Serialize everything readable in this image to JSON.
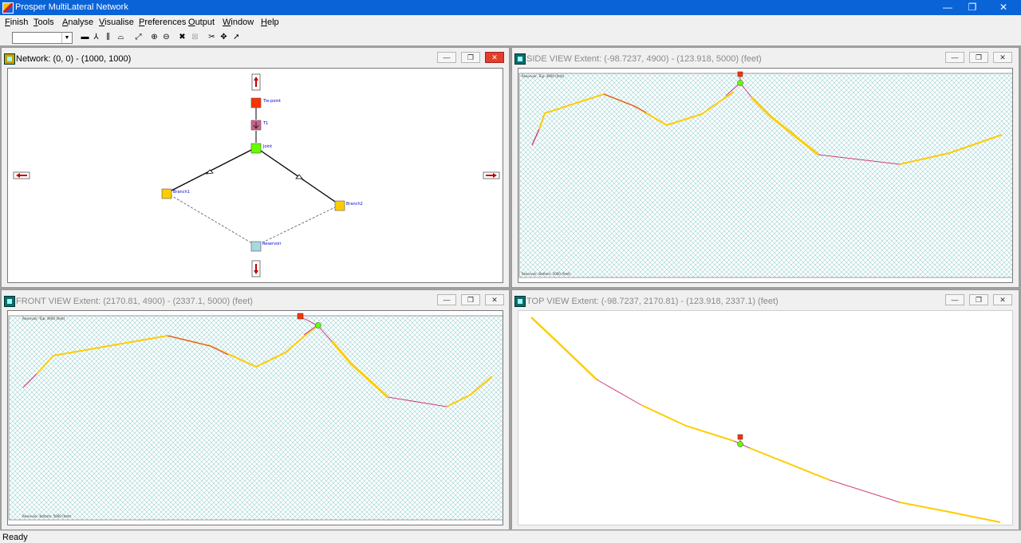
{
  "app": {
    "title": "Prosper MultiLateral Network"
  },
  "window_controls": {
    "minimize": "—",
    "restore": "❐",
    "close": "✕"
  },
  "menu": [
    {
      "label": "Finish",
      "u": "F"
    },
    {
      "label": "Tools",
      "u": "T"
    },
    {
      "label": "Analyse",
      "u": "A"
    },
    {
      "label": "Visualise",
      "u": "V"
    },
    {
      "label": "Preferences",
      "u": "P"
    },
    {
      "label": "Output",
      "u": "O"
    },
    {
      "label": "Window",
      "u": "W"
    },
    {
      "label": "Help",
      "u": "H"
    }
  ],
  "toolbar": {
    "combo_value": "",
    "combo_arrow": "▼",
    "buttons": [
      {
        "name": "line-tool-icon",
        "glyph": "▬"
      },
      {
        "name": "branch-tool-icon",
        "glyph": "⅄"
      },
      {
        "name": "pump-tool-icon",
        "glyph": "⫼"
      },
      {
        "name": "tank-tool-icon",
        "glyph": "⌓"
      },
      {
        "name": "zoom-fit-icon",
        "glyph": "⤢"
      },
      {
        "name": "zoom-in-icon",
        "glyph": "⊕"
      },
      {
        "name": "zoom-out-icon",
        "glyph": "⊖"
      },
      {
        "name": "delete-icon",
        "glyph": "✖"
      },
      {
        "name": "delete-disabled-icon",
        "glyph": "⊠"
      },
      {
        "name": "cut-icon",
        "glyph": "✂"
      },
      {
        "name": "move-icon",
        "glyph": "✥"
      },
      {
        "name": "pointer-icon",
        "glyph": "➚"
      }
    ]
  },
  "windows": {
    "network": {
      "title": "Network: (0, 0) - (1000, 1000)",
      "nodes": {
        "tie_point": "Tie-point",
        "t1": "T1",
        "joint": "Joint",
        "branch1": "Branch1",
        "branch2": "Branch2",
        "reservoir": "Reservoir"
      }
    },
    "side_view": {
      "title": "SIDE VIEW Extent: (-98.7237, 4900) - (123.918, 5000) (feet)",
      "reservoir_top": "Reservoir: Top: 4900 (feet)",
      "reservoir_bottom": "Reservoir: Bottom: 5000 (feet)"
    },
    "front_view": {
      "title": "FRONT VIEW Extent: (2170.81, 4900) - (2337.1, 5000) (feet)",
      "reservoir_top": "Reservoir: Top: 4900 (feet)",
      "reservoir_bottom": "Reservoir: Bottom: 5000 (feet)"
    },
    "top_view": {
      "title": "TOP VIEW Extent: (-98.7237, 2170.81) - (123.918, 2337.1) (feet)"
    }
  },
  "status": {
    "text": "Ready"
  },
  "colors": {
    "title_bar": "#0a64d8",
    "well_yellow": "#ffcc00",
    "well_pink": "#d04080",
    "node_red": "#ff3300",
    "node_green": "#66ff00",
    "hatch": "#9ad0d0"
  }
}
